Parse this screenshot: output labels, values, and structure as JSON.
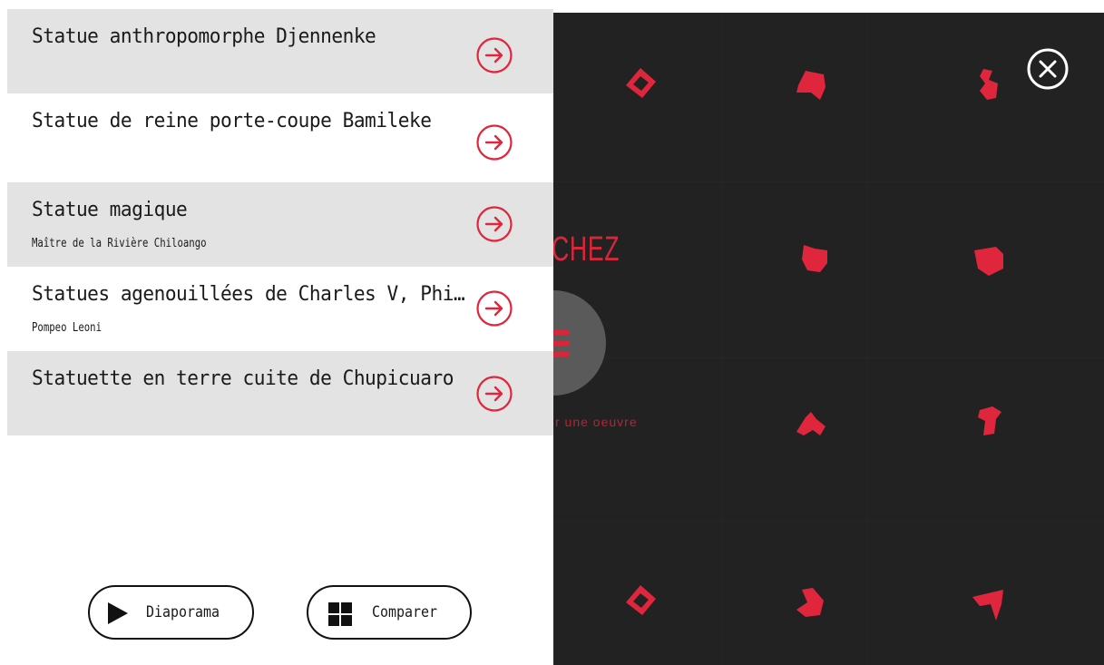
{
  "results": [
    {
      "title": "Statue anthropomorphe Djennenke",
      "subtitle": ""
    },
    {
      "title": "Statue de reine porte-coupe Bamileke",
      "subtitle": ""
    },
    {
      "title": "Statue magique",
      "subtitle": "Maître de la Rivière Chiloango"
    },
    {
      "title": "Statues agenouillées de Charles V, Phi…",
      "subtitle": "Pompeo Leoni"
    },
    {
      "title": "Statuette en terre cuite de Chupicuaro",
      "subtitle": ""
    }
  ],
  "actions": {
    "slideshow_label": "Diaporama",
    "compare_label": "Comparer"
  },
  "background": {
    "heading_fragment": "CHEZ",
    "sub_fragment": "r une oeuvre"
  },
  "icons": {
    "item_arrow": "arrow-right-circle-icon",
    "close": "close-circle-icon",
    "slideshow": "play-icon",
    "compare": "grid-icon"
  },
  "colors": {
    "accent": "#e0263c",
    "dark_panel": "#222222",
    "shaded_row": "#e3e3e3",
    "text": "#1a1a1a"
  }
}
